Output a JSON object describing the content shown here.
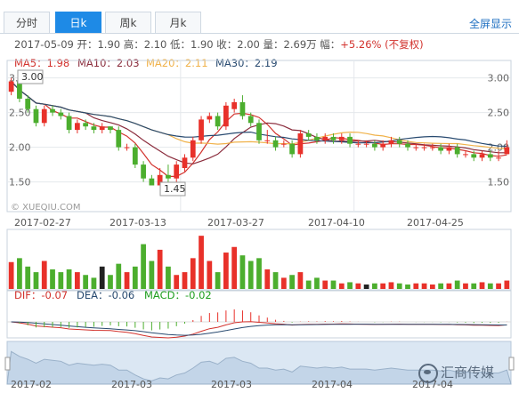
{
  "tabs": [
    {
      "label": "分时",
      "active": false
    },
    {
      "label": "日k",
      "active": true
    },
    {
      "label": "周k",
      "active": false
    },
    {
      "label": "月k",
      "active": false
    }
  ],
  "fullscreen_label": "全屏显示",
  "info": {
    "prefix": "2017-05-09 开：1.90 高：2.10 低：1.90 收：2.00 量：2.69万 幅：",
    "change": "+5.26%",
    "tag": "(不复权)"
  },
  "ma_labels": [
    {
      "text": "MA5：1.98",
      "color": "#d2322d"
    },
    {
      "text": "MA10：2.03",
      "color": "#8b2d3d"
    },
    {
      "text": "MA20：2.11",
      "color": "#f0b24a"
    },
    {
      "text": "MA30：2.19",
      "color": "#284a70"
    }
  ],
  "macd_labels": [
    {
      "text": "DIF：-0.07",
      "color": "#d2322d"
    },
    {
      "text": "DEA：-0.06",
      "color": "#284a70"
    },
    {
      "text": "MACD：-0.02",
      "color": "#1e9e1e"
    }
  ],
  "watermark": "© XUEQIU.COM",
  "logo_text": "汇商传媒",
  "colors": {
    "up": "#e8312a",
    "down": "#4cae2e",
    "grid": "#e4e8ec"
  },
  "chart_data": {
    "type": "candlestick",
    "price_axis": {
      "ticks": [
        "3.00",
        "2.50",
        "2.00",
        "1.50"
      ],
      "min": 1.2,
      "max": 3.2
    },
    "date_labels": [
      "2017-02-27",
      "2017-03-13",
      "2017-03-27",
      "2017-04-10",
      "2017-04-25"
    ],
    "overview_labels": [
      "2017-02",
      "2017-03",
      "2017-03",
      "2017-04",
      "2017-04"
    ],
    "max_label": "3.00",
    "min_label": "1.45",
    "candles": [
      [
        2.8,
        2.95,
        2.75,
        3.0
      ],
      [
        2.95,
        2.7,
        2.65,
        2.98
      ],
      [
        2.7,
        2.55,
        2.5,
        2.75
      ],
      [
        2.55,
        2.35,
        2.3,
        2.6
      ],
      [
        2.35,
        2.55,
        2.3,
        2.6
      ],
      [
        2.55,
        2.5,
        2.45,
        2.6
      ],
      [
        2.5,
        2.45,
        2.4,
        2.55
      ],
      [
        2.45,
        2.25,
        2.2,
        2.5
      ],
      [
        2.25,
        2.35,
        2.2,
        2.4
      ],
      [
        2.35,
        2.3,
        2.25,
        2.4
      ],
      [
        2.3,
        2.25,
        2.2,
        2.35
      ],
      [
        2.25,
        2.3,
        2.2,
        2.35
      ],
      [
        2.3,
        2.25,
        2.2,
        2.3
      ],
      [
        2.25,
        2.0,
        1.95,
        2.3
      ],
      [
        2.0,
        2.0,
        1.95,
        2.05
      ],
      [
        2.0,
        1.75,
        1.7,
        2.05
      ],
      [
        1.75,
        1.55,
        1.5,
        1.8
      ],
      [
        1.55,
        1.45,
        1.45,
        1.6
      ],
      [
        1.45,
        1.6,
        1.45,
        1.7
      ],
      [
        1.6,
        1.55,
        1.5,
        1.75
      ],
      [
        1.55,
        1.75,
        1.5,
        1.8
      ],
      [
        1.7,
        1.85,
        1.65,
        1.9
      ],
      [
        1.85,
        2.1,
        1.8,
        2.15
      ],
      [
        2.1,
        2.4,
        2.05,
        2.45
      ],
      [
        2.4,
        2.45,
        2.35,
        2.5
      ],
      [
        2.45,
        2.3,
        2.25,
        2.5
      ],
      [
        2.3,
        2.6,
        2.25,
        2.65
      ],
      [
        2.55,
        2.65,
        2.5,
        2.7
      ],
      [
        2.65,
        2.45,
        2.4,
        2.75
      ],
      [
        2.45,
        2.35,
        2.3,
        2.5
      ],
      [
        2.35,
        2.1,
        2.05,
        2.4
      ],
      [
        2.1,
        2.1,
        2.05,
        2.25
      ],
      [
        2.1,
        2.0,
        1.95,
        2.15
      ],
      [
        2.05,
        2.05,
        2.0,
        2.1
      ],
      [
        2.05,
        1.9,
        1.85,
        2.1
      ],
      [
        1.9,
        2.2,
        1.85,
        2.25
      ],
      [
        2.2,
        2.15,
        2.1,
        2.25
      ],
      [
        2.15,
        2.1,
        2.05,
        2.2
      ],
      [
        2.1,
        2.15,
        2.05,
        2.2
      ],
      [
        2.15,
        2.1,
        2.05,
        2.2
      ],
      [
        2.1,
        2.15,
        2.05,
        2.2
      ],
      [
        2.15,
        2.05,
        2.0,
        2.2
      ],
      [
        2.05,
        2.05,
        2.0,
        2.1
      ],
      [
        2.05,
        2.05,
        2.0,
        2.1
      ],
      [
        2.05,
        2.0,
        1.95,
        2.1
      ],
      [
        2.0,
        2.05,
        1.95,
        2.1
      ],
      [
        2.05,
        2.1,
        2.0,
        2.15
      ],
      [
        2.1,
        2.05,
        2.0,
        2.15
      ],
      [
        2.05,
        2.0,
        1.95,
        2.1
      ],
      [
        2.0,
        2.0,
        1.95,
        2.05
      ],
      [
        2.0,
        2.0,
        1.95,
        2.05
      ],
      [
        2.0,
        2.0,
        1.95,
        2.05
      ],
      [
        2.0,
        1.95,
        1.9,
        2.05
      ],
      [
        1.95,
        2.0,
        1.9,
        2.05
      ],
      [
        2.0,
        1.9,
        1.85,
        2.05
      ],
      [
        1.9,
        1.9,
        1.85,
        1.95
      ],
      [
        1.9,
        1.85,
        1.8,
        1.95
      ],
      [
        1.85,
        1.9,
        1.8,
        1.95
      ],
      [
        1.9,
        1.85,
        1.8,
        1.95
      ],
      [
        1.85,
        1.85,
        1.8,
        1.95
      ],
      [
        1.9,
        2.0,
        1.9,
        2.1
      ]
    ],
    "volume_rel": [
      0.48,
      0.55,
      0.4,
      0.3,
      0.5,
      0.35,
      0.3,
      0.35,
      0.3,
      0.25,
      0.2,
      0.4,
      0.25,
      0.45,
      0.3,
      0.4,
      0.8,
      0.5,
      0.7,
      0.4,
      0.25,
      0.3,
      0.55,
      0.95,
      0.5,
      0.3,
      0.65,
      0.75,
      0.6,
      0.5,
      0.55,
      0.35,
      0.3,
      0.2,
      0.25,
      0.3,
      0.15,
      0.2,
      0.15,
      0.15,
      0.1,
      0.12,
      0.1,
      0.08,
      0.1,
      0.1,
      0.12,
      0.1,
      0.08,
      0.1,
      0.1,
      0.08,
      0.1,
      0.1,
      0.15,
      0.1,
      0.1,
      0.12,
      0.1,
      0.1,
      0.15
    ],
    "neutral_volume_idx": [
      11,
      43
    ]
  }
}
